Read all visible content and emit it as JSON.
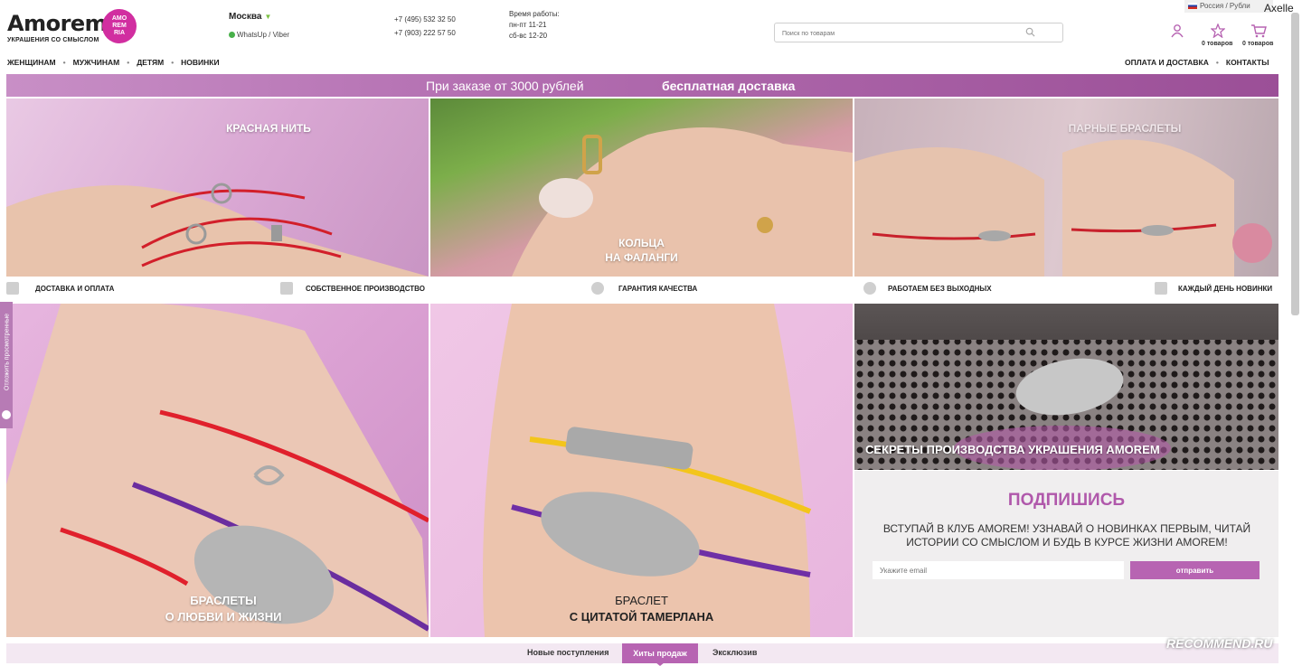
{
  "header": {
    "logo": "Amorem",
    "logo_sub": "УКРАШЕНИЯ СО СМЫСЛОМ",
    "logo_badge": "AMO REM RIA",
    "city": "Москва",
    "messengers": "WhatsUp / Viber",
    "phone1": "+7 (495) 532 32 50",
    "phone2": "+7 (903) 222 57 50",
    "hours_title": "Время работы:",
    "hours_weekdays": "пн-пт 11-21",
    "hours_weekend": "сб-вс 12-20",
    "search_placeholder": "Поиск по товарам",
    "locale": "Россия / Рубли",
    "user": "Axelle",
    "wishlist_label": "0 товаров",
    "cart_label": "0 товаров"
  },
  "nav": {
    "left": [
      "ЖЕНЩИНАМ",
      "МУЖЧИНАМ",
      "ДЕТЯМ",
      "НОВИНКИ"
    ],
    "right": [
      "ОПЛАТА И ДОСТАВКА",
      "КОНТАКТЫ"
    ]
  },
  "promo": {
    "part1": "При заказе от 3000 рублей",
    "part2": "бесплатная доставка"
  },
  "tiles": {
    "red_thread": "КРАСНАЯ НИТЬ",
    "rings_line1": "КОЛЬЦА",
    "rings_line2": "НА ФАЛАНГИ",
    "pair": "ПАРНЫЕ БРАСЛЕТЫ",
    "love_line1": "БРАСЛЕТЫ",
    "love_line2": "О ЛЮБВИ И ЖИЗНИ",
    "quote_line1": "БРАСЛЕТ",
    "quote_line2": "С ЦИТАТОЙ ТАМЕРЛАНА",
    "secrets": "СЕКРЕТЫ ПРОИЗВОДСТВА УКРАШЕНИЯ AMOREM"
  },
  "features": [
    "ДОСТАВКА И ОПЛАТА",
    "СОБСТВЕННОЕ ПРОИЗВОДСТВО",
    "ГАРАНТИЯ КАЧЕСТВА",
    "РАБОТАЕМ БЕЗ ВЫХОДНЫХ",
    "КАЖДЫЙ ДЕНЬ НОВИНКИ"
  ],
  "side_tab": "Отложить просмотренные",
  "subscribe": {
    "title": "ПОДПИШИСЬ",
    "text": "ВСТУПАЙ В КЛУБ AMOREM! УЗНАВАЙ О НОВИНКАХ ПЕРВЫМ, ЧИТАЙ ИСТОРИИ СО СМЫСЛОМ И БУДЬ В КУРСЕ ЖИЗНИ AMOREM!",
    "placeholder": "Укажите email",
    "button": "отправить"
  },
  "bottom_tabs": [
    "Новые поступления",
    "Хиты продаж",
    "Эксклюзив"
  ],
  "watermark": "RECOMMEND.RU",
  "colors": {
    "accent": "#b764b2",
    "promo": "#b26db0",
    "title": "#b058ab"
  }
}
